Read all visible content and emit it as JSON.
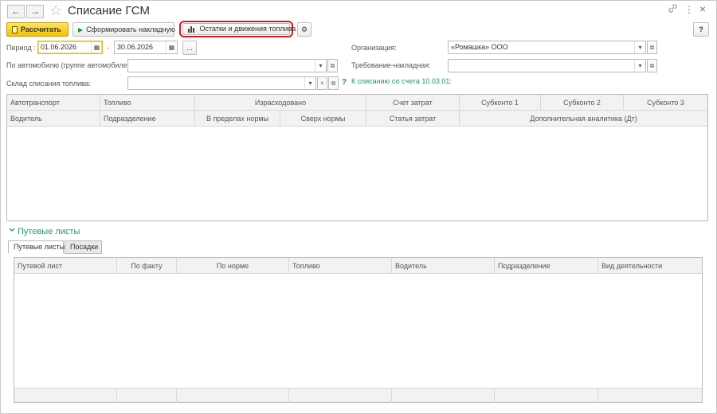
{
  "window": {
    "title": "Списание ГСМ"
  },
  "icons": {
    "back": "←",
    "forward": "→",
    "star": "☆",
    "link": "🔗",
    "more": "⋮",
    "close": "×",
    "calendar": "▦",
    "dropdown": "▾",
    "open": "⧉",
    "clear": "×",
    "settings": "⚙",
    "help": "?",
    "chevron": "⌄"
  },
  "toolbar": {
    "calculate": "Рассчитать",
    "create_invoice": "Сформировать накладную",
    "fuel_balances": "Остатки и движения топлива"
  },
  "form": {
    "period_label": "Период :",
    "period_from": "01.06.2026",
    "period_dash": "-",
    "period_to": "30.06.2026",
    "period_more": "...",
    "vehicle_label": "По автомобилю (группе автомобилей):",
    "vehicle_value": "",
    "warehouse_label": "Склад списания топлива:",
    "warehouse_value": "",
    "org_label": "Организация:",
    "org_value": "«Ромашка» ООО",
    "requirement_label": "Требование-накладная:",
    "requirement_value": "",
    "writeoff_note": "К списанию со счета 10.03.01:",
    "help_mark": "?"
  },
  "main_table": {
    "header_row1": [
      "Автотранспорт",
      "Топливо",
      "Израсходовано",
      "Счет затрат",
      "Субконто 1",
      "Субконто 2",
      "Субконто 3"
    ],
    "header_row2": [
      "Водитель",
      "Подразделение",
      "В пределах нормы",
      "Сверх нормы",
      "Статья затрат",
      "Дополнительная аналитика (Дт)"
    ]
  },
  "waybills_section": {
    "title": "Путевые листы",
    "tabs": [
      "Путевые листы",
      "Посадки"
    ],
    "columns": [
      "Путевой лист",
      "По факту",
      "По норме",
      "Топливо",
      "Водитель",
      "Подразделение",
      "Вид деятельности"
    ]
  },
  "colors": {
    "accent_green": "#18a05a",
    "button_yellow": "#f2c300",
    "highlight_red": "#d21b1b"
  }
}
